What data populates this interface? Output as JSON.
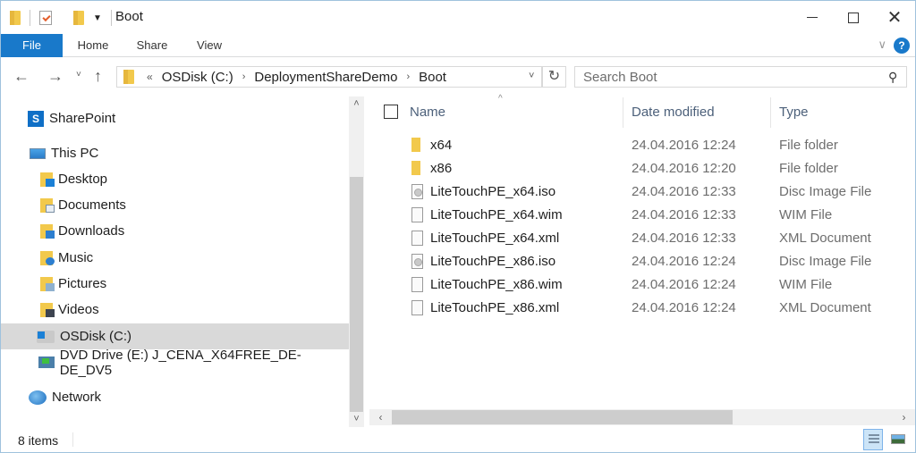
{
  "window": {
    "title": "Boot",
    "controls": {
      "minimize": "minimize",
      "maximize": "maximize",
      "close": "close"
    }
  },
  "quick_access_toolbar": {
    "icons": [
      "folder-icon",
      "properties-icon",
      "new-folder-icon",
      "customize-dropdown-icon"
    ]
  },
  "ribbon": {
    "tabs": [
      {
        "label": "File",
        "active": true
      },
      {
        "label": "Home"
      },
      {
        "label": "Share"
      },
      {
        "label": "View"
      }
    ],
    "help_label": "?",
    "accent_color": "#1979ca"
  },
  "navigation": {
    "back": "←",
    "forward": "→",
    "recent": "˅",
    "up": "↑",
    "breadcrumb_overflow": "«",
    "breadcrumb": [
      "OSDisk (C:)",
      "DeploymentShareDemo",
      "Boot"
    ],
    "crumb_separator": "›",
    "refresh": "↻",
    "dropdown": "˅"
  },
  "search": {
    "placeholder": "Search Boot",
    "value": ""
  },
  "sidebar": {
    "items": [
      {
        "label": "SharePoint",
        "icon": "sharepoint-icon",
        "indent": 0
      },
      {
        "label": "This PC",
        "icon": "computer-icon",
        "indent": 0
      },
      {
        "label": "Desktop",
        "icon": "desktop-folder-icon",
        "indent": 1
      },
      {
        "label": "Documents",
        "icon": "documents-folder-icon",
        "indent": 1
      },
      {
        "label": "Downloads",
        "icon": "downloads-folder-icon",
        "indent": 1
      },
      {
        "label": "Music",
        "icon": "music-folder-icon",
        "indent": 1
      },
      {
        "label": "Pictures",
        "icon": "pictures-folder-icon",
        "indent": 1
      },
      {
        "label": "Videos",
        "icon": "videos-folder-icon",
        "indent": 1
      },
      {
        "label": "OSDisk (C:)",
        "icon": "system-drive-icon",
        "indent": 1,
        "selected": true
      },
      {
        "label": "DVD Drive (E:) J_CENA_X64FREE_DE-DE_DV5",
        "icon": "dvd-drive-icon",
        "indent": 1
      },
      {
        "label": "Network",
        "icon": "network-icon",
        "indent": 0
      }
    ]
  },
  "file_list": {
    "columns": [
      "Name",
      "Date modified",
      "Type"
    ],
    "sort_indicator": "^",
    "rows": [
      {
        "name": "x64",
        "date": "24.04.2016 12:24",
        "type": "File folder",
        "icon": "folder-icon"
      },
      {
        "name": "x86",
        "date": "24.04.2016 12:20",
        "type": "File folder",
        "icon": "folder-icon"
      },
      {
        "name": "LiteTouchPE_x64.iso",
        "date": "24.04.2016 12:33",
        "type": "Disc Image File",
        "icon": "disc-image-icon"
      },
      {
        "name": "LiteTouchPE_x64.wim",
        "date": "24.04.2016 12:33",
        "type": "WIM File",
        "icon": "file-icon"
      },
      {
        "name": "LiteTouchPE_x64.xml",
        "date": "24.04.2016 12:33",
        "type": "XML Document",
        "icon": "file-icon"
      },
      {
        "name": "LiteTouchPE_x86.iso",
        "date": "24.04.2016 12:24",
        "type": "Disc Image File",
        "icon": "disc-image-icon"
      },
      {
        "name": "LiteTouchPE_x86.wim",
        "date": "24.04.2016 12:24",
        "type": "WIM File",
        "icon": "file-icon"
      },
      {
        "name": "LiteTouchPE_x86.xml",
        "date": "24.04.2016 12:24",
        "type": "XML Document",
        "icon": "file-icon"
      }
    ]
  },
  "scrollbars": {
    "up": "˄",
    "down": "˅",
    "left": "‹",
    "right": "›"
  },
  "status_bar": {
    "item_count": "8 items",
    "view_buttons": [
      "details-view",
      "large-icons-view"
    ],
    "active_view": "details-view"
  }
}
